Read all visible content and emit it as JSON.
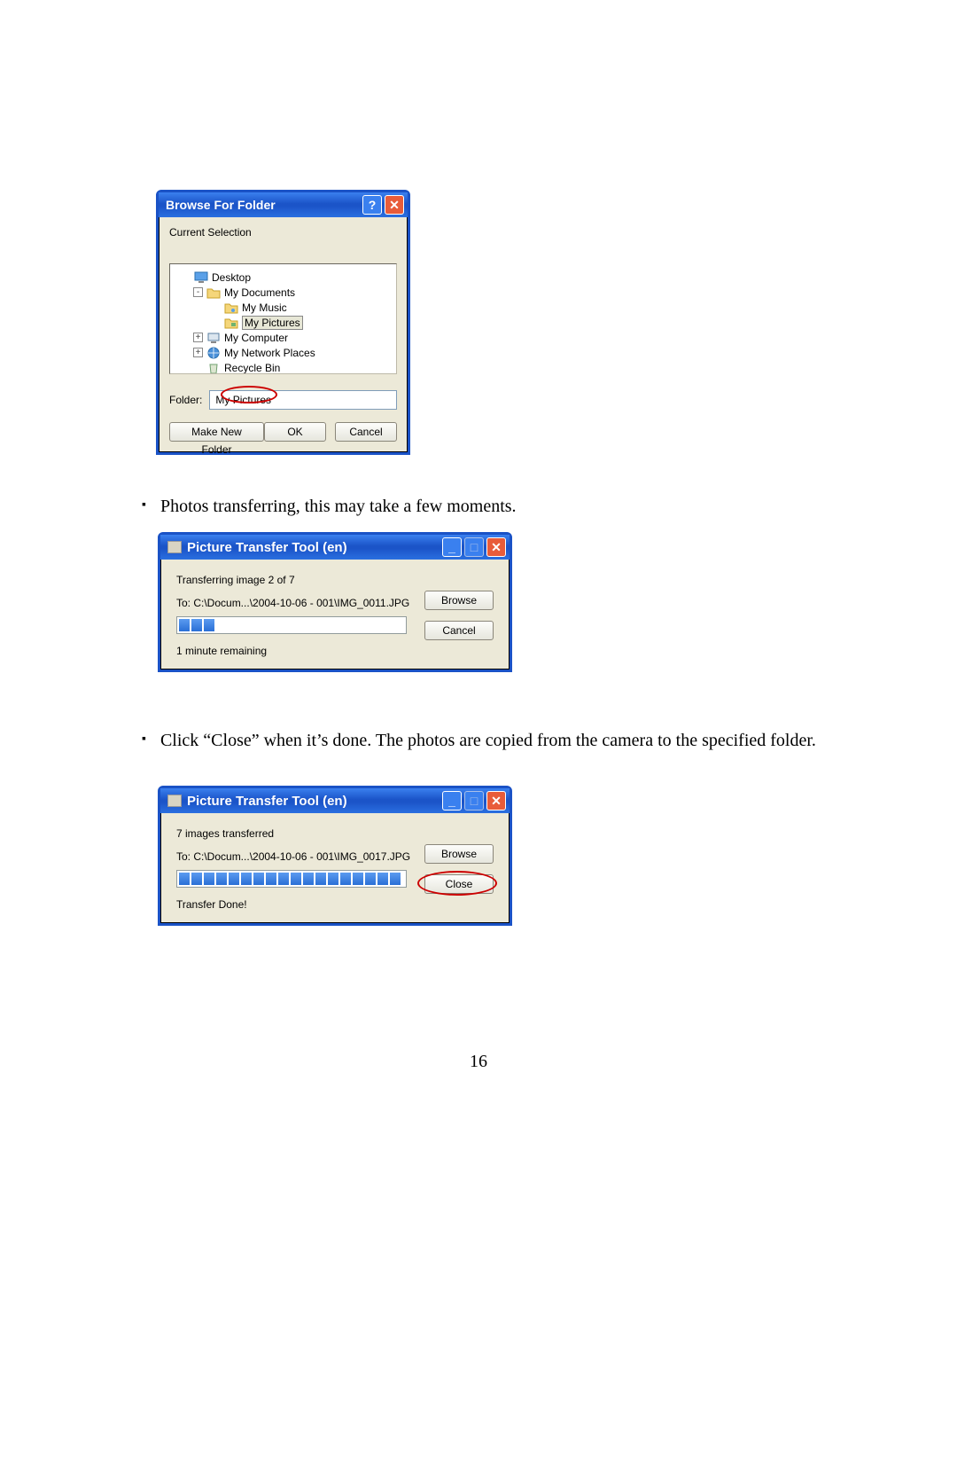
{
  "browse_dialog": {
    "title": "Browse For Folder",
    "subtitle": "Current Selection",
    "tree": [
      {
        "indent": 1,
        "toggle": "",
        "icon": "desktop-icon",
        "label": "Desktop",
        "selected": false
      },
      {
        "indent": 2,
        "toggle": "-",
        "icon": "folder-icon",
        "label": "My Documents",
        "selected": false
      },
      {
        "indent": 3,
        "toggle": "",
        "icon": "folder-music-icon",
        "label": "My Music",
        "selected": false
      },
      {
        "indent": 3,
        "toggle": "",
        "icon": "folder-pictures-icon",
        "label": "My Pictures",
        "selected": true
      },
      {
        "indent": 2,
        "toggle": "+",
        "icon": "computer-icon",
        "label": "My Computer",
        "selected": false
      },
      {
        "indent": 2,
        "toggle": "+",
        "icon": "network-icon",
        "label": "My Network Places",
        "selected": false
      },
      {
        "indent": 2,
        "toggle": "",
        "icon": "recycle-icon",
        "label": "Recycle Bin",
        "selected": false
      }
    ],
    "folder_label": "Folder:",
    "folder_value": "My Pictures",
    "make_new_folder": "Make New Folder",
    "ok": "OK",
    "cancel": "Cancel"
  },
  "bullet_1": "Photos transferring, this may take a few moments.",
  "bullet_2": "Click “Close” when it’s done.  The photos are copied from the camera to the specified folder.",
  "transfer_1": {
    "title": "Picture Transfer Tool (en)",
    "status_line": "Transferring image 2 of 7",
    "to_line": "To: C:\\Docum...\\2004-10-06 - 001\\IMG_0011.JPG",
    "browse": "Browse",
    "cancel": "Cancel",
    "remaining": "1 minute remaining",
    "progress_segments": 3,
    "progress_total": 18
  },
  "transfer_2": {
    "title": "Picture Transfer Tool (en)",
    "status_line": "7 images transferred",
    "to_line": "To: C:\\Docum...\\2004-10-06 - 001\\IMG_0017.JPG",
    "browse": "Browse",
    "close": "Close",
    "done": "Transfer Done!",
    "progress_segments": 18,
    "progress_total": 18
  },
  "page_number": "16"
}
